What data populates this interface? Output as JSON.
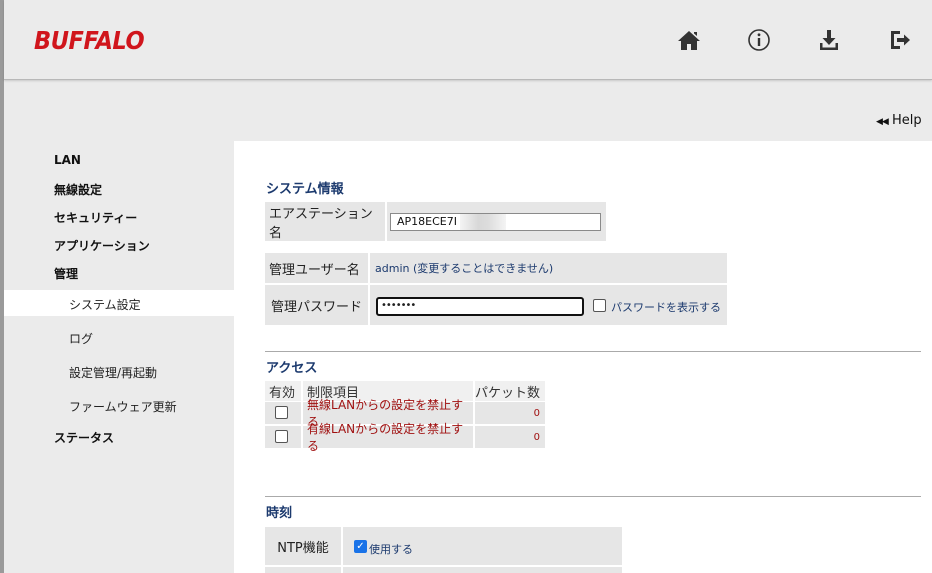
{
  "header": {
    "logo": "BUFFALO",
    "icons": [
      "home-icon",
      "info-icon",
      "download-icon",
      "logout-icon"
    ]
  },
  "help": {
    "label": "Help"
  },
  "nav": {
    "lan": "LAN",
    "wireless": "無線設定",
    "security": "セキュリティー",
    "application": "アプリケーション",
    "management": "管理",
    "system_settings": "システム設定",
    "log": "ログ",
    "config_reboot": "設定管理/再起動",
    "firmware": "ファームウェア更新",
    "status": "ステータス"
  },
  "system": {
    "title": "システム情報",
    "ap_name_label": "エアステーション名",
    "ap_name_value": "AP18ECE7I",
    "admin_user_label": "管理ユーザー名",
    "admin_user_value": "admin (変更することはできません)",
    "admin_pw_label": "管理パスワード",
    "admin_pw_value": "•••••••",
    "show_pw_label": "パスワードを表示する"
  },
  "access": {
    "title": "アクセス",
    "headers": {
      "enabled": "有効",
      "item": "制限項目",
      "packets": "パケット数"
    },
    "rows": [
      {
        "item": "無線LANからの設定を禁止する",
        "packets": "0"
      },
      {
        "item": "有線LANからの設定を禁止する",
        "packets": "0"
      }
    ]
  },
  "time": {
    "title": "時刻",
    "ntp_label": "NTP機能",
    "ntp_use": "使用する"
  },
  "colors": {
    "brand": "#d0151c",
    "section": "#1c3a6e",
    "warning": "#a01010"
  }
}
